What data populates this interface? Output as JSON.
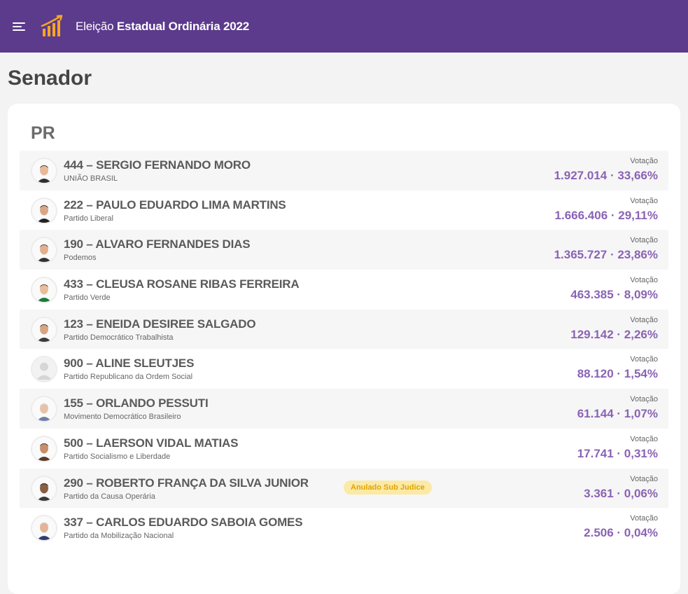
{
  "header": {
    "title_prefix": "Eleição",
    "title_bold": "Estadual Ordinária 2022"
  },
  "page": {
    "title": "Senador",
    "state": "PR"
  },
  "vote_label": "Votação",
  "candidates": [
    {
      "name": "444 – SERGIO FERNANDO MORO",
      "party": "UNIÃO BRASIL",
      "votes": "1.927.014 · 33,66%",
      "badge": "",
      "avatar": "photo"
    },
    {
      "name": "222 – PAULO EDUARDO LIMA MARTINS",
      "party": "Partido Liberal",
      "votes": "1.666.406 · 29,11%",
      "badge": "",
      "avatar": "photo"
    },
    {
      "name": "190 – ALVARO FERNANDES DIAS",
      "party": "Podemos",
      "votes": "1.365.727 · 23,86%",
      "badge": "",
      "avatar": "photo"
    },
    {
      "name": "433 – CLEUSA ROSANE RIBAS FERREIRA",
      "party": "Partido Verde",
      "votes": "463.385 · 8,09%",
      "badge": "",
      "avatar": "photo"
    },
    {
      "name": "123 – ENEIDA DESIREE SALGADO",
      "party": "Partido Democrático Trabalhista",
      "votes": "129.142 · 2,26%",
      "badge": "",
      "avatar": "photo"
    },
    {
      "name": "900 – ALINE SLEUTJES",
      "party": "Partido Republicano da Ordem Social",
      "votes": "88.120 · 1,54%",
      "badge": "",
      "avatar": "placeholder"
    },
    {
      "name": "155 – ORLANDO PESSUTI",
      "party": "Movimento Democrático Brasileiro",
      "votes": "61.144 · 1,07%",
      "badge": "",
      "avatar": "photo"
    },
    {
      "name": "500 – LAERSON VIDAL MATIAS",
      "party": "Partido Socialismo e Liberdade",
      "votes": "17.741 · 0,31%",
      "badge": "",
      "avatar": "photo"
    },
    {
      "name": "290 – ROBERTO FRANÇA DA SILVA JUNIOR",
      "party": "Partido da Causa Operária",
      "votes": "3.361 · 0,06%",
      "badge": "Anulado Sub Judice",
      "avatar": "photo"
    },
    {
      "name": "337 – CARLOS EDUARDO SABOIA GOMES",
      "party": "Partido da Mobilização Nacional",
      "votes": "2.506 · 0,04%",
      "badge": "",
      "avatar": "photo"
    }
  ],
  "colors": {
    "header_bg": "#5c3a8c",
    "logo_orange": "#f5a623",
    "vote_purple": "#8a63b5",
    "badge_bg": "#fbe9a6",
    "badge_text": "#e2a400"
  },
  "icons": {
    "menu": "hamburger-menu-icon",
    "logo": "bar-chart-logo-icon"
  }
}
